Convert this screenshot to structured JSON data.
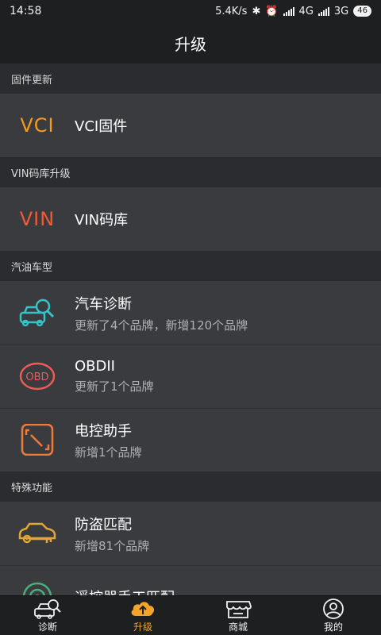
{
  "status": {
    "time": "14:58",
    "speed": "5.4K/s",
    "net1": "4G",
    "net2": "3G",
    "battery": "46"
  },
  "header": {
    "title": "升级"
  },
  "sections": [
    {
      "label": "固件更新",
      "items": [
        {
          "title": "VCI固件",
          "icon": "vci-text-icon",
          "icon_text": "VCI"
        }
      ]
    },
    {
      "label": "VIN码库升级",
      "items": [
        {
          "title": "VIN码库",
          "icon": "vin-text-icon",
          "icon_text": "VIN"
        }
      ]
    },
    {
      "label": "汽油车型",
      "items": [
        {
          "title": "汽车诊断",
          "subtitle": "更新了4个品牌，新增120个品牌",
          "icon": "car-diagnosis-icon"
        },
        {
          "title": "OBDII",
          "subtitle": "更新了1个品牌",
          "icon": "obd-icon",
          "icon_text": "OBD"
        },
        {
          "title": "电控助手",
          "subtitle": "新增1个品牌",
          "icon": "ecu-assistant-icon"
        }
      ]
    },
    {
      "label": "特殊功能",
      "items": [
        {
          "title": "防盗匹配",
          "subtitle": "新增81个品牌",
          "icon": "anti-theft-car-key-icon"
        },
        {
          "title": "遥控器手工匹配",
          "icon": "remote-control-icon"
        }
      ]
    }
  ],
  "tabs": [
    {
      "label": "诊断",
      "icon": "diagnosis-car-icon"
    },
    {
      "label": "升级",
      "icon": "cloud-upload-icon",
      "active": true
    },
    {
      "label": "商城",
      "icon": "shop-icon"
    },
    {
      "label": "我的",
      "icon": "profile-icon"
    }
  ],
  "colors": {
    "accent": "#f3a42a",
    "vci": "#f39a1f",
    "vin": "#f05a34",
    "teal": "#35c3c8",
    "obd": "#ee5a5a",
    "ecu": "#f07a3a",
    "key": "#e4a533",
    "remote": "#4cae77"
  }
}
